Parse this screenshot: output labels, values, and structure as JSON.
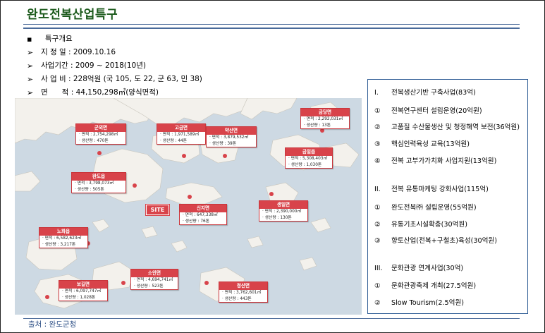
{
  "title": "완도전복산업특구",
  "intro": {
    "heading": "특구개요",
    "bullet_marker": "▪",
    "arrow_marker": "➢",
    "rows": [
      {
        "label": "지 정 일",
        "sep": " : ",
        "value": "2009.10.16"
      },
      {
        "label": "사업기간",
        "sep": " : ",
        "value": "2009 ~ 2018(10년)"
      },
      {
        "label": "사 업 비",
        "sep": " : ",
        "value": "228억원 (국 105, 도 22, 군 63, 민 38)"
      },
      {
        "label": "면      적",
        "sep": " : ",
        "value": "44,150,298㎡(양식면적)"
      }
    ]
  },
  "map": {
    "site_label": "SITE",
    "callouts": [
      {
        "name": "군외면",
        "area": "· 면적 : 2,754,298㎡",
        "prod": "· 생산량 : 470톤"
      },
      {
        "name": "고금면",
        "area": "· 면적 : 1,971,589㎡",
        "prod": "· 생산량 : 44톤"
      },
      {
        "name": "약산면",
        "area": "· 면적 : 3,879,532㎡",
        "prod": "· 생산량 : 39톤"
      },
      {
        "name": "금당면",
        "area": "· 면적 : 2,292,031㎡",
        "prod": "· 생산량 : 13톤"
      },
      {
        "name": "완도읍",
        "area": "· 면적 : 3,798,073㎡",
        "prod": "· 생산량 : 505톤"
      },
      {
        "name": "금일읍",
        "area": "· 면적 : 5,308,403㎡",
        "prod": "· 생산량 : 1,030톤"
      },
      {
        "name": "신지면",
        "area": "· 면적 : 647,338㎡",
        "prod": "· 생산량 : 76톤"
      },
      {
        "name": "생일면",
        "area": "· 면적 : 2,390,000㎡",
        "prod": "· 생산량 : 130톤"
      },
      {
        "name": "노화읍",
        "area": "· 면적 : 6,582,623㎡",
        "prod": "· 생산량 : 3,217톤"
      },
      {
        "name": "소안면",
        "area": "· 면적 : 4,694,741㎡",
        "prod": "· 생산량 : 523톤"
      },
      {
        "name": "보길면",
        "area": "· 면적 : 6,097,747㎡",
        "prod": "· 생산량 : 1,028톤"
      },
      {
        "name": "청산면",
        "area": "· 면적 : 3,762,601㎡",
        "prod": "· 생산량 : 443톤"
      }
    ]
  },
  "panel": {
    "items": [
      {
        "mark": "I.",
        "text": "전복생산기반 구축사업(83억)"
      },
      {
        "mark": "①",
        "text": "전복연구센터 설립운영(20억원)"
      },
      {
        "mark": "②",
        "text": "고품질 수산물생산 및 청정해역 보전(36억원)"
      },
      {
        "mark": "③",
        "text": "핵심인력육성 교육(13억원)"
      },
      {
        "mark": "④",
        "text": "전복 고부가가치화 사업지원(13억원)"
      },
      {
        "mark": "II.",
        "text": "전복 유통마케팅 강화사업(115억)"
      },
      {
        "mark": "①",
        "text": "완도전복㈜ 설립운영(55억원)"
      },
      {
        "mark": "②",
        "text": "유통기초시설확충(30억원)"
      },
      {
        "mark": "③",
        "text": "향토산업(전복+구철초)육성(30억원)"
      },
      {
        "mark": "III.",
        "text": "문화관광 연계사업(30억)"
      },
      {
        "mark": "①",
        "text": "문화관광축제 개최(27.5억원)"
      },
      {
        "mark": "②",
        "text": "Slow Tourism(2.5억원)"
      }
    ]
  },
  "source": "출처 : 완도군청",
  "colors": {
    "title": "#1c5a1c",
    "accent": "#d8434a",
    "panel_border": "#2d5b94",
    "sea": "#cdd9e3",
    "land": "#f3f1ec"
  }
}
